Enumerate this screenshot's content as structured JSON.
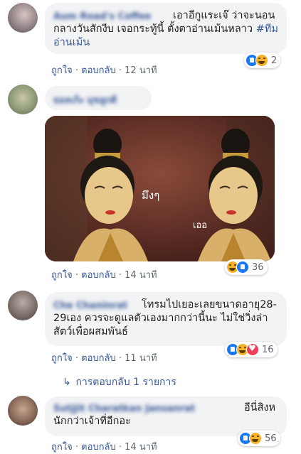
{
  "comments": [
    {
      "name": "Aum Road's Coffee",
      "text": "เอาอีกูแระเจ๊ ว่าจะนอนกลางวันสักงีบ เจอกระทู้นี้ ตั้งตาอ่านเม้นหลาว",
      "hashtag": "#ทีมอ่านเม้น",
      "like": "ถูกใจ",
      "reply": "ตอบกลับ",
      "time": "12 นาที",
      "reaction_count": "2",
      "reactions": [
        "like-icon",
        "haha-icon"
      ]
    },
    {
      "name": "ธอลเก้ะ มุขลูกดิ",
      "image_texts": [
        "มึงๆ",
        "เออ"
      ],
      "like": "ถูกใจ",
      "reply": "ตอบกลับ",
      "time": "14 นาที",
      "reaction_count": "36",
      "reactions": [
        "haha-icon",
        "like-icon"
      ]
    },
    {
      "name": "Che Chaninrat",
      "text": "โทรมไปเยอะเลยขนาดอายุ28-29เอง ควรจะดูแลตัวเองมากกว่านี้นะ ไม่ใช่วิ่งล่าสัตว์เพื่อผสมพันธ์",
      "like": "ถูกใจ",
      "reply": "ตอบกลับ",
      "time": "11 นาที",
      "reaction_count": "16",
      "reactions": [
        "like-icon",
        "haha-icon",
        "love-icon"
      ],
      "replies_label": "การตอบกลับ 1 รายการ"
    },
    {
      "name": "Sutjjit Charatkan Jansanrat",
      "text": "อีนี่สิงหนักกว่าเจ้าที่อีกอะ",
      "like": "ถูกใจ",
      "reply": "ตอบกลับ",
      "time": "14 นาที",
      "reaction_count": "56",
      "reactions": [
        "like-icon",
        "haha-icon"
      ]
    }
  ],
  "separator": "·",
  "colors": {
    "link": "#385898",
    "bubble": "#f2f3f5",
    "like": "#1877f2",
    "haha": "#f7b125",
    "love": "#f33e58"
  }
}
